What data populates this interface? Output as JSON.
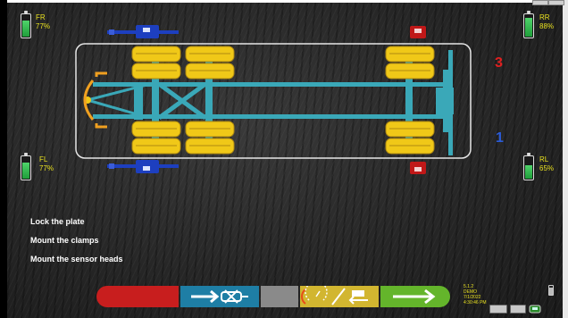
{
  "wheels": {
    "front_right": {
      "label": "FR",
      "percent": "77%",
      "charge": 0.77
    },
    "rear_right": {
      "label": "RR",
      "percent": "88%",
      "charge": 0.88
    },
    "front_left": {
      "label": "FL",
      "percent": "77%",
      "charge": 0.77
    },
    "rear_left": {
      "label": "RL",
      "percent": "65%",
      "charge": 0.65
    }
  },
  "markers": {
    "red_number": "3",
    "blue_number": "1"
  },
  "instructions": [
    "Lock the plate",
    "Mount the clamps",
    "Mount the sensor heads"
  ],
  "colors": {
    "label_yellow": "#e8e020",
    "sensor_blue": "#1d3fbf",
    "sensor_red": "#c01818",
    "tire_yellow": "#f0c818",
    "frame_teal": "#3aa8b8",
    "accent_orange": "#f0a020"
  },
  "action_bar": [
    {
      "name": "red-action",
      "color": "#c81e1e"
    },
    {
      "name": "blue-action",
      "color": "#1e7ea5",
      "icon": "arrow-to-wheel-icon"
    },
    {
      "name": "gray-action",
      "color": "#8a8a8a"
    },
    {
      "name": "yellow-action",
      "color": "#d2b630",
      "icon": "gauge-tool-icon"
    },
    {
      "name": "green-action",
      "color": "#64b52b",
      "icon": "right-arrow-icon"
    }
  ],
  "status": {
    "version": "5.1.2",
    "mode": "DEMO",
    "date": "7/1/2022",
    "time": "4:30:46 PM"
  }
}
